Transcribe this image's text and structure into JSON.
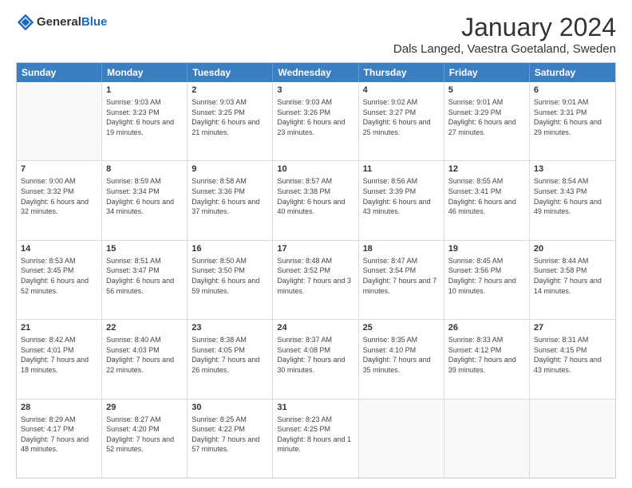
{
  "header": {
    "logo": {
      "general": "General",
      "blue": "Blue"
    },
    "title": "January 2024",
    "subtitle": "Dals Langed, Vaestra Goetaland, Sweden"
  },
  "days": [
    "Sunday",
    "Monday",
    "Tuesday",
    "Wednesday",
    "Thursday",
    "Friday",
    "Saturday"
  ],
  "weeks": [
    [
      {
        "day": "",
        "empty": true
      },
      {
        "day": "1",
        "sunrise": "Sunrise: 9:03 AM",
        "sunset": "Sunset: 3:23 PM",
        "daylight": "Daylight: 6 hours and 19 minutes."
      },
      {
        "day": "2",
        "sunrise": "Sunrise: 9:03 AM",
        "sunset": "Sunset: 3:25 PM",
        "daylight": "Daylight: 6 hours and 21 minutes."
      },
      {
        "day": "3",
        "sunrise": "Sunrise: 9:03 AM",
        "sunset": "Sunset: 3:26 PM",
        "daylight": "Daylight: 6 hours and 23 minutes."
      },
      {
        "day": "4",
        "sunrise": "Sunrise: 9:02 AM",
        "sunset": "Sunset: 3:27 PM",
        "daylight": "Daylight: 6 hours and 25 minutes."
      },
      {
        "day": "5",
        "sunrise": "Sunrise: 9:01 AM",
        "sunset": "Sunset: 3:29 PM",
        "daylight": "Daylight: 6 hours and 27 minutes."
      },
      {
        "day": "6",
        "sunrise": "Sunrise: 9:01 AM",
        "sunset": "Sunset: 3:31 PM",
        "daylight": "Daylight: 6 hours and 29 minutes."
      }
    ],
    [
      {
        "day": "7",
        "sunrise": "Sunrise: 9:00 AM",
        "sunset": "Sunset: 3:32 PM",
        "daylight": "Daylight: 6 hours and 32 minutes."
      },
      {
        "day": "8",
        "sunrise": "Sunrise: 8:59 AM",
        "sunset": "Sunset: 3:34 PM",
        "daylight": "Daylight: 6 hours and 34 minutes."
      },
      {
        "day": "9",
        "sunrise": "Sunrise: 8:58 AM",
        "sunset": "Sunset: 3:36 PM",
        "daylight": "Daylight: 6 hours and 37 minutes."
      },
      {
        "day": "10",
        "sunrise": "Sunrise: 8:57 AM",
        "sunset": "Sunset: 3:38 PM",
        "daylight": "Daylight: 6 hours and 40 minutes."
      },
      {
        "day": "11",
        "sunrise": "Sunrise: 8:56 AM",
        "sunset": "Sunset: 3:39 PM",
        "daylight": "Daylight: 6 hours and 43 minutes."
      },
      {
        "day": "12",
        "sunrise": "Sunrise: 8:55 AM",
        "sunset": "Sunset: 3:41 PM",
        "daylight": "Daylight: 6 hours and 46 minutes."
      },
      {
        "day": "13",
        "sunrise": "Sunrise: 8:54 AM",
        "sunset": "Sunset: 3:43 PM",
        "daylight": "Daylight: 6 hours and 49 minutes."
      }
    ],
    [
      {
        "day": "14",
        "sunrise": "Sunrise: 8:53 AM",
        "sunset": "Sunset: 3:45 PM",
        "daylight": "Daylight: 6 hours and 52 minutes."
      },
      {
        "day": "15",
        "sunrise": "Sunrise: 8:51 AM",
        "sunset": "Sunset: 3:47 PM",
        "daylight": "Daylight: 6 hours and 56 minutes."
      },
      {
        "day": "16",
        "sunrise": "Sunrise: 8:50 AM",
        "sunset": "Sunset: 3:50 PM",
        "daylight": "Daylight: 6 hours and 59 minutes."
      },
      {
        "day": "17",
        "sunrise": "Sunrise: 8:48 AM",
        "sunset": "Sunset: 3:52 PM",
        "daylight": "Daylight: 7 hours and 3 minutes."
      },
      {
        "day": "18",
        "sunrise": "Sunrise: 8:47 AM",
        "sunset": "Sunset: 3:54 PM",
        "daylight": "Daylight: 7 hours and 7 minutes."
      },
      {
        "day": "19",
        "sunrise": "Sunrise: 8:45 AM",
        "sunset": "Sunset: 3:56 PM",
        "daylight": "Daylight: 7 hours and 10 minutes."
      },
      {
        "day": "20",
        "sunrise": "Sunrise: 8:44 AM",
        "sunset": "Sunset: 3:58 PM",
        "daylight": "Daylight: 7 hours and 14 minutes."
      }
    ],
    [
      {
        "day": "21",
        "sunrise": "Sunrise: 8:42 AM",
        "sunset": "Sunset: 4:01 PM",
        "daylight": "Daylight: 7 hours and 18 minutes."
      },
      {
        "day": "22",
        "sunrise": "Sunrise: 8:40 AM",
        "sunset": "Sunset: 4:03 PM",
        "daylight": "Daylight: 7 hours and 22 minutes."
      },
      {
        "day": "23",
        "sunrise": "Sunrise: 8:38 AM",
        "sunset": "Sunset: 4:05 PM",
        "daylight": "Daylight: 7 hours and 26 minutes."
      },
      {
        "day": "24",
        "sunrise": "Sunrise: 8:37 AM",
        "sunset": "Sunset: 4:08 PM",
        "daylight": "Daylight: 7 hours and 30 minutes."
      },
      {
        "day": "25",
        "sunrise": "Sunrise: 8:35 AM",
        "sunset": "Sunset: 4:10 PM",
        "daylight": "Daylight: 7 hours and 35 minutes."
      },
      {
        "day": "26",
        "sunrise": "Sunrise: 8:33 AM",
        "sunset": "Sunset: 4:12 PM",
        "daylight": "Daylight: 7 hours and 39 minutes."
      },
      {
        "day": "27",
        "sunrise": "Sunrise: 8:31 AM",
        "sunset": "Sunset: 4:15 PM",
        "daylight": "Daylight: 7 hours and 43 minutes."
      }
    ],
    [
      {
        "day": "28",
        "sunrise": "Sunrise: 8:29 AM",
        "sunset": "Sunset: 4:17 PM",
        "daylight": "Daylight: 7 hours and 48 minutes."
      },
      {
        "day": "29",
        "sunrise": "Sunrise: 8:27 AM",
        "sunset": "Sunset: 4:20 PM",
        "daylight": "Daylight: 7 hours and 52 minutes."
      },
      {
        "day": "30",
        "sunrise": "Sunrise: 8:25 AM",
        "sunset": "Sunset: 4:22 PM",
        "daylight": "Daylight: 7 hours and 57 minutes."
      },
      {
        "day": "31",
        "sunrise": "Sunrise: 8:23 AM",
        "sunset": "Sunset: 4:25 PM",
        "daylight": "Daylight: 8 hours and 1 minute."
      },
      {
        "day": "",
        "empty": true
      },
      {
        "day": "",
        "empty": true
      },
      {
        "day": "",
        "empty": true
      }
    ]
  ]
}
